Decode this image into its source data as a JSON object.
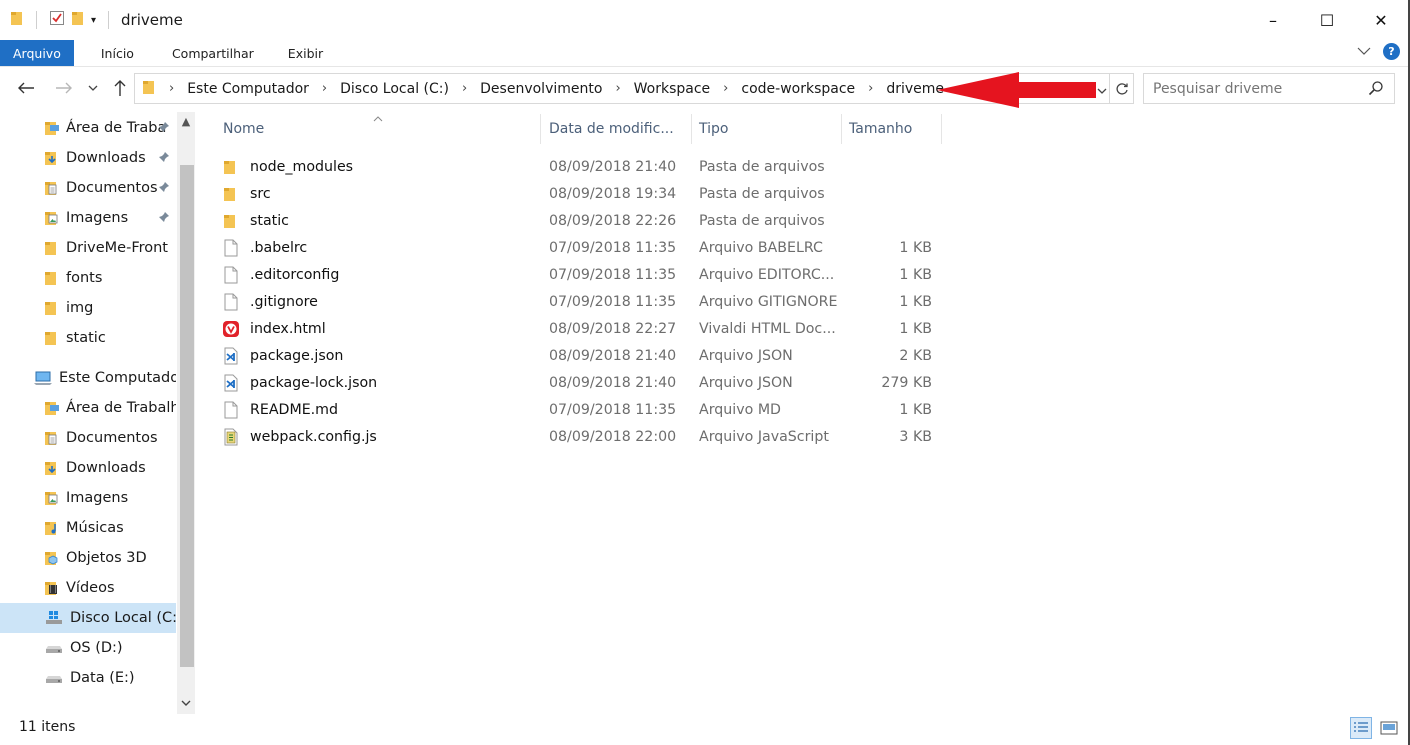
{
  "window": {
    "title": "driveme",
    "controls": {
      "minimize": "–",
      "maximize": "☐",
      "close": "✕"
    }
  },
  "ribbon": {
    "tabs": [
      "Arquivo",
      "Início",
      "Compartilhar",
      "Exibir"
    ],
    "help": "?"
  },
  "address": {
    "crumbs": [
      "Este Computador",
      "Disco Local (C:)",
      "Desenvolvimento",
      "Workspace",
      "code-workspace",
      "driveme"
    ]
  },
  "search": {
    "placeholder": "Pesquisar driveme"
  },
  "annotation": {
    "arrow_color": "#e5141f"
  },
  "sidebar": {
    "quick_access": [
      {
        "label": "Área de Traba",
        "icon": "folder-desktop-icon",
        "pinned": true
      },
      {
        "label": "Downloads",
        "icon": "folder-downloads-icon",
        "pinned": true
      },
      {
        "label": "Documentos",
        "icon": "folder-documents-icon",
        "pinned": true
      },
      {
        "label": "Imagens",
        "icon": "folder-pictures-icon",
        "pinned": true
      },
      {
        "label": "DriveMe-Front",
        "icon": "folder-icon",
        "pinned": false
      },
      {
        "label": "fonts",
        "icon": "folder-icon",
        "pinned": false
      },
      {
        "label": "img",
        "icon": "folder-icon",
        "pinned": false
      },
      {
        "label": "static",
        "icon": "folder-icon",
        "pinned": false
      }
    ],
    "this_pc": {
      "label": "Este Computador",
      "icon": "computer-icon"
    },
    "pc_items": [
      {
        "label": "Área de Trabalho",
        "icon": "folder-desktop-icon"
      },
      {
        "label": "Documentos",
        "icon": "folder-documents-icon"
      },
      {
        "label": "Downloads",
        "icon": "folder-downloads-icon"
      },
      {
        "label": "Imagens",
        "icon": "folder-pictures-icon"
      },
      {
        "label": "Músicas",
        "icon": "folder-music-icon"
      },
      {
        "label": "Objetos 3D",
        "icon": "folder-3d-icon"
      },
      {
        "label": "Vídeos",
        "icon": "folder-videos-icon"
      },
      {
        "label": "Disco Local (C:)",
        "icon": "windows-drive-icon",
        "selected": true
      },
      {
        "label": "OS (D:)",
        "icon": "drive-icon"
      },
      {
        "label": "Data (E:)",
        "icon": "drive-icon"
      }
    ]
  },
  "columns": {
    "name": "Nome",
    "date": "Data de modific...",
    "type": "Tipo",
    "size": "Tamanho"
  },
  "files": [
    {
      "name": "node_modules",
      "date": "08/09/2018 21:40",
      "type": "Pasta de arquivos",
      "size": "",
      "icon": "folder-icon"
    },
    {
      "name": "src",
      "date": "08/09/2018 19:34",
      "type": "Pasta de arquivos",
      "size": "",
      "icon": "folder-icon"
    },
    {
      "name": "static",
      "date": "08/09/2018 22:26",
      "type": "Pasta de arquivos",
      "size": "",
      "icon": "folder-icon"
    },
    {
      "name": ".babelrc",
      "date": "07/09/2018 11:35",
      "type": "Arquivo BABELRC",
      "size": "1 KB",
      "icon": "file-icon"
    },
    {
      "name": ".editorconfig",
      "date": "07/09/2018 11:35",
      "type": "Arquivo EDITORC...",
      "size": "1 KB",
      "icon": "file-icon"
    },
    {
      "name": ".gitignore",
      "date": "07/09/2018 11:35",
      "type": "Arquivo GITIGNORE",
      "size": "1 KB",
      "icon": "file-icon"
    },
    {
      "name": "index.html",
      "date": "08/09/2018 22:27",
      "type": "Vivaldi HTML Doc...",
      "size": "1 KB",
      "icon": "vivaldi-icon"
    },
    {
      "name": "package.json",
      "date": "08/09/2018 21:40",
      "type": "Arquivo JSON",
      "size": "2 KB",
      "icon": "vscode-file-icon"
    },
    {
      "name": "package-lock.json",
      "date": "08/09/2018 21:40",
      "type": "Arquivo JSON",
      "size": "279 KB",
      "icon": "vscode-file-icon"
    },
    {
      "name": "README.md",
      "date": "07/09/2018 11:35",
      "type": "Arquivo MD",
      "size": "1 KB",
      "icon": "file-icon"
    },
    {
      "name": "webpack.config.js",
      "date": "08/09/2018 22:00",
      "type": "Arquivo JavaScript",
      "size": "3 KB",
      "icon": "script-file-icon"
    }
  ],
  "status": {
    "count": "11 itens"
  }
}
